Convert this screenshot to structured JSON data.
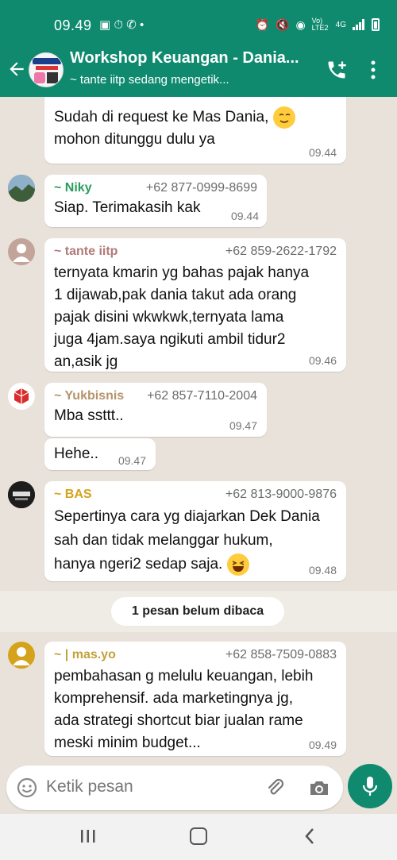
{
  "status_bar": {
    "time": "09.49",
    "net_label": "Vo) LTE2",
    "net_type": "4G"
  },
  "header": {
    "title": "Workshop Keuangan - Dania...",
    "subtitle": "~ tante iitp sedang mengetik..."
  },
  "messages": [
    {
      "id": "m1",
      "sender": "",
      "phone": "",
      "text_lines": [
        "Sudah di request ke Mas Dania,",
        "mohon ditunggu dulu ya"
      ],
      "time": "09.44"
    },
    {
      "id": "m2",
      "sender": "~ Niky",
      "phone": "+62 877-0999-8699",
      "sender_color": "#2a9d5c",
      "text_lines": [
        "Siap. Terimakasih kak"
      ],
      "time": "09.44"
    },
    {
      "id": "m3",
      "sender": "~ tante iitp",
      "phone": "+62 859-2622-1792",
      "sender_color": "#b07a7a",
      "text_lines": [
        "ternyata kmarin yg bahas pajak hanya",
        "1 dijawab,pak dania takut ada orang",
        "pajak disini wkwkwk,ternyata lama",
        "juga 4jam.saya ngikuti ambil tidur2",
        "an,asik jg"
      ],
      "time": "09.46"
    },
    {
      "id": "m4",
      "sender": "~ Yukbisnis",
      "phone": "+62 857-7110-2004",
      "sender_color": "#b5946a",
      "text_lines": [
        "Mba ssttt.."
      ],
      "time": "09.47"
    },
    {
      "id": "m5",
      "sender": "",
      "phone": "",
      "text_lines": [
        "Hehe.."
      ],
      "time": "09.47"
    },
    {
      "id": "m6",
      "sender": "~ BAS",
      "phone": "+62 813-9000-9876",
      "sender_color": "#d4a21b",
      "text_lines": [
        "Sepertinya cara yg diajarkan Dek Dania",
        "sah dan tidak melanggar hukum,",
        "hanya ngeri2 sedap saja."
      ],
      "time": "09.48"
    },
    {
      "id": "m7",
      "sender": "~ | mas.yo",
      "phone": "+62 858-7509-0883",
      "sender_color": "#c2a23a",
      "text_lines": [
        "pembahasan g melulu keuangan, lebih",
        "komprehensif. ada marketingnya jg,",
        "ada strategi shortcut biar jualan rame",
        "meski minim budget..."
      ],
      "time": "09.49"
    }
  ],
  "unread_banner": "1 pesan belum dibaca",
  "composer": {
    "placeholder": "Ketik pesan"
  },
  "colors": {
    "brand": "#0f8a6f",
    "chat_bg": "#e9e2da",
    "bubble": "#ffffff"
  },
  "icons": [
    "back-arrow-icon",
    "add-call-icon",
    "menu-dots-icon",
    "emoji-icon",
    "attach-icon",
    "camera-icon",
    "mic-icon",
    "nav-recent-icon",
    "nav-home-icon",
    "nav-back-icon"
  ]
}
